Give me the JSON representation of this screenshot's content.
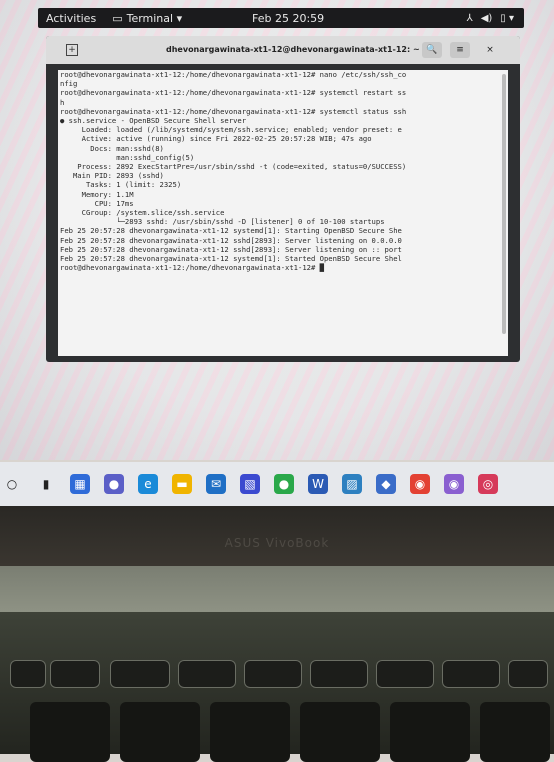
{
  "topbar": {
    "activities": "Activities",
    "app_menu": "Terminal ▾",
    "clock": "Feb 25 20:59",
    "tray": [
      "⅄",
      "◀)",
      "▯ ▾"
    ]
  },
  "terminal": {
    "title": "dhevonargawinata-xt1-12@dhevonargawinata-xt1-12: ~",
    "buttons": {
      "search": "🔍",
      "menu": "≡",
      "close": "×"
    },
    "lines": [
      "root@dhevonargawinata-xt1-12:/home/dhevonargawinata-xt1-12# nano /etc/ssh/ssh_co",
      "nfig",
      "root@dhevonargawinata-xt1-12:/home/dhevonargawinata-xt1-12# systemctl restart ss",
      "h",
      "root@dhevonargawinata-xt1-12:/home/dhevonargawinata-xt1-12# systemctl status ssh",
      "● ssh.service - OpenBSD Secure Shell server",
      "     Loaded: loaded (/lib/systemd/system/ssh.service; enabled; vendor preset: e",
      "     Active: active (running) since Fri 2022-02-25 20:57:28 WIB; 47s ago",
      "       Docs: man:sshd(8)",
      "             man:sshd_config(5)",
      "    Process: 2892 ExecStartPre=/usr/sbin/sshd -t (code=exited, status=0/SUCCESS)",
      "   Main PID: 2893 (sshd)",
      "      Tasks: 1 (limit: 2325)",
      "     Memory: 1.1M",
      "        CPU: 17ms",
      "     CGroup: /system.slice/ssh.service",
      "             └─2893 sshd: /usr/sbin/sshd -D [listener] 0 of 10-100 startups",
      "",
      "Feb 25 20:57:28 dhevonargawinata-xt1-12 systemd[1]: Starting OpenBSD Secure She",
      "Feb 25 20:57:28 dhevonargawinata-xt1-12 sshd[2893]: Server listening on 0.0.0.0",
      "Feb 25 20:57:28 dhevonargawinata-xt1-12 sshd[2893]: Server listening on :: port",
      "Feb 25 20:57:28 dhevonargawinata-xt1-12 systemd[1]: Started OpenBSD Secure Shel",
      "",
      "root@dhevonargawinata-xt1-12:/home/dhevonargawinata-xt1-12# █"
    ]
  },
  "taskbar": {
    "icons": [
      {
        "name": "search-icon",
        "glyph": "○",
        "color": "#e6e8ec",
        "fg": "#222"
      },
      {
        "name": "task-view-icon",
        "glyph": "▮",
        "color": "#e6e8ec",
        "fg": "#222"
      },
      {
        "name": "widgets-icon",
        "glyph": "▦",
        "color": "#2f6bd8",
        "fg": "#fff"
      },
      {
        "name": "chat-icon",
        "glyph": "●",
        "color": "#5b5fc7",
        "fg": "#fff"
      },
      {
        "name": "edge-icon",
        "glyph": "e",
        "color": "#1a8ad8",
        "fg": "#fff"
      },
      {
        "name": "file-explorer-icon",
        "glyph": "▬",
        "color": "#f0b400",
        "fg": "#fff"
      },
      {
        "name": "mail-icon",
        "glyph": "✉",
        "color": "#1f6fc5",
        "fg": "#fff"
      },
      {
        "name": "photos-icon",
        "glyph": "▧",
        "color": "#3b4ad0",
        "fg": "#fff"
      },
      {
        "name": "app-icon",
        "glyph": "●",
        "color": "#2aa84a",
        "fg": "#fff"
      },
      {
        "name": "word-icon",
        "glyph": "W",
        "color": "#2b5ab4",
        "fg": "#fff"
      },
      {
        "name": "image-viewer-icon",
        "glyph": "▨",
        "color": "#2d80c0",
        "fg": "#fff"
      },
      {
        "name": "app-icon-2",
        "glyph": "◆",
        "color": "#3a6cc8",
        "fg": "#fff"
      },
      {
        "name": "chrome-icon",
        "glyph": "◉",
        "color": "#e34133",
        "fg": "#fff"
      },
      {
        "name": "app-icon-3",
        "glyph": "◉",
        "color": "#8a5fd0",
        "fg": "#fff"
      },
      {
        "name": "app-icon-4",
        "glyph": "◎",
        "color": "#d63a5a",
        "fg": "#fff"
      }
    ]
  },
  "laptop": {
    "brand": "ASUS VivoBook"
  }
}
